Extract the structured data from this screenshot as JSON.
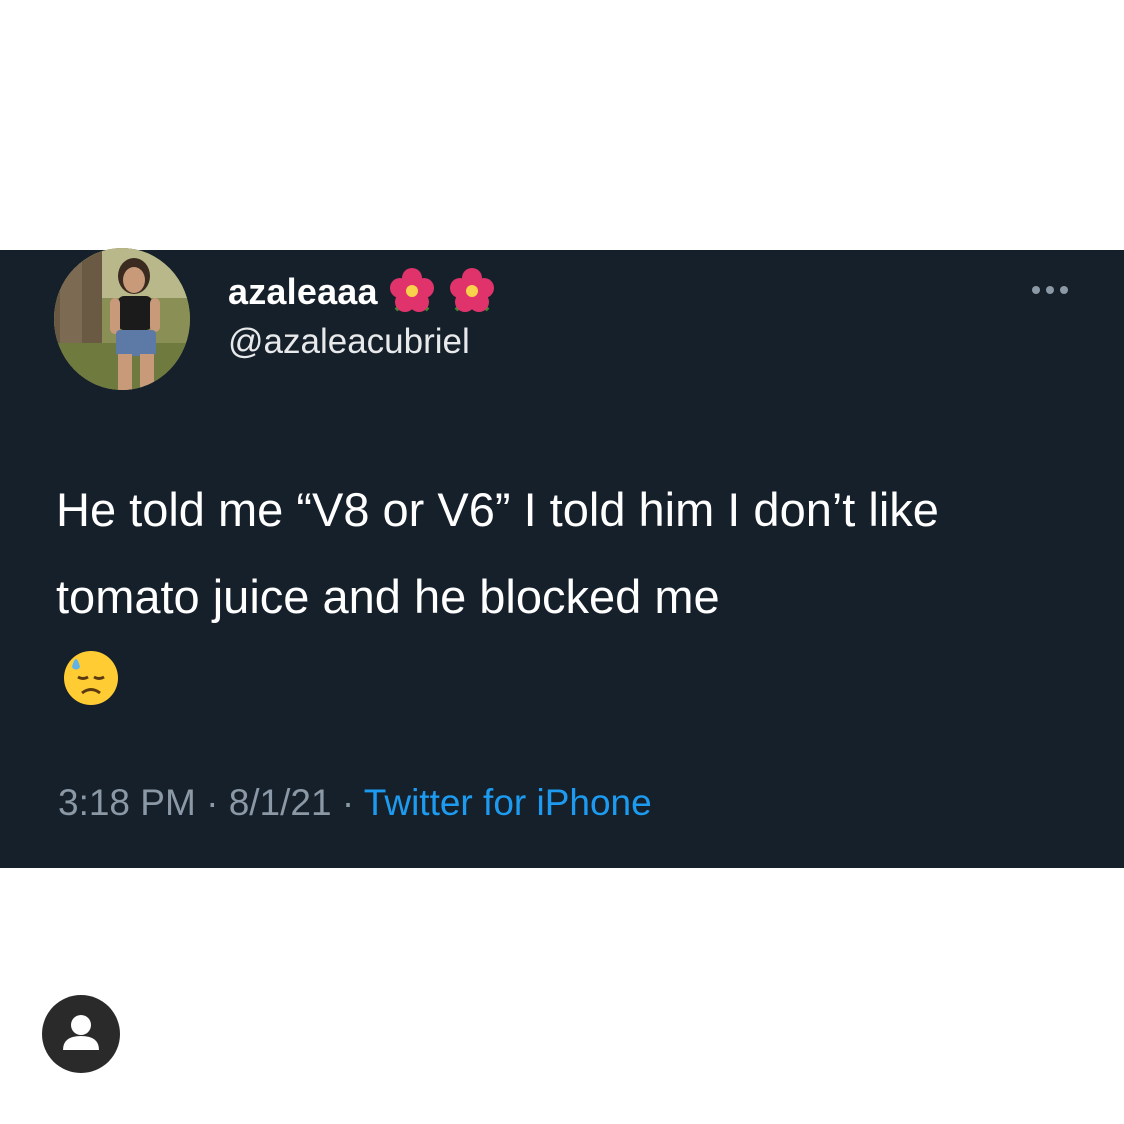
{
  "tweet": {
    "display_name": "azaleaaa",
    "name_emojis": [
      "hibiscus-icon",
      "hibiscus-icon"
    ],
    "handle": "@azaleacubriel",
    "text": "He told me “V8 or V6” I told him I don’t like tomato juice and he blocked me",
    "emoji": "downcast-face-with-sweat-icon",
    "time": "3:18 PM",
    "separator": "·",
    "date": "8/1/21",
    "source": "Twitter for iPhone"
  },
  "colors": {
    "card_background": "#15202b",
    "text": "#ffffff",
    "secondary_text": "#8b98a5",
    "link": "#1d9bf0",
    "page_background": "#ffffff"
  },
  "overlay": {
    "icon": "user-profile-icon"
  }
}
